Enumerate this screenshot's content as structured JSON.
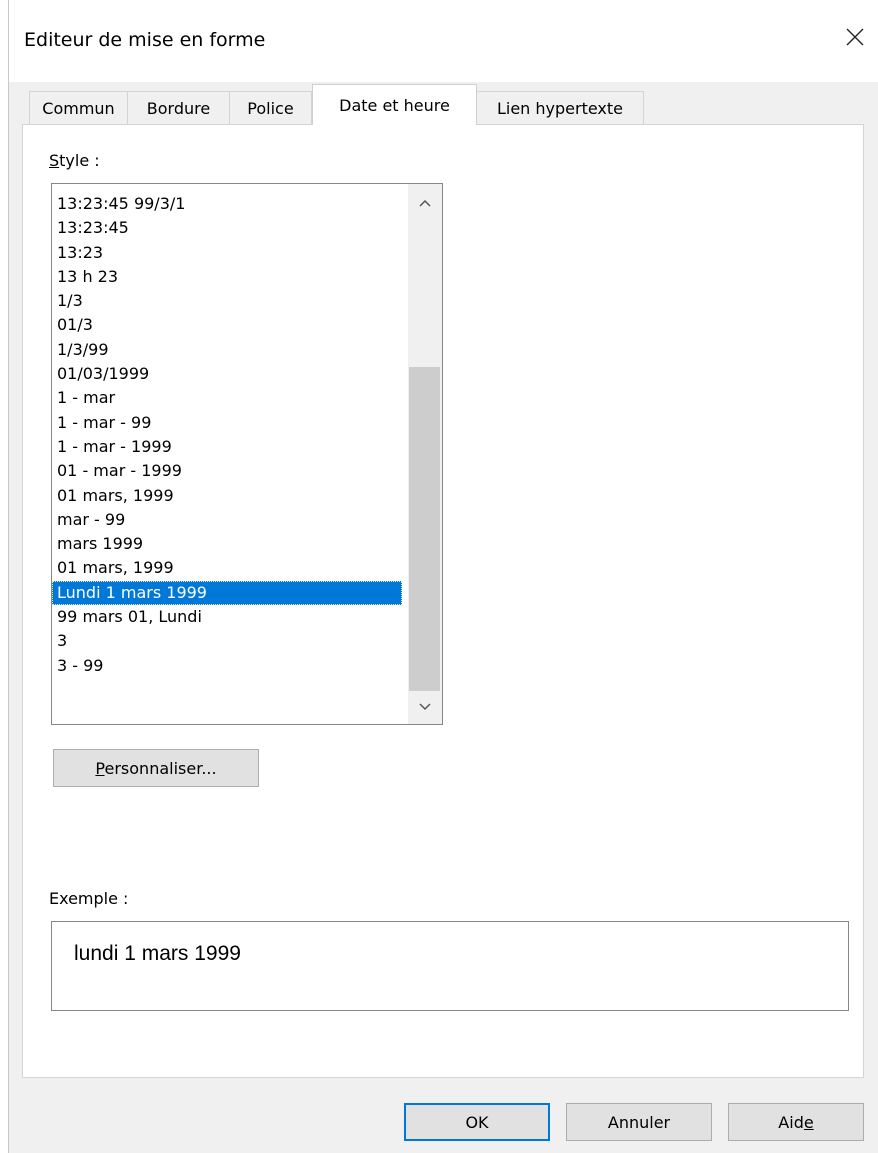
{
  "window": {
    "title": "Editeur de mise en forme",
    "close_icon": "close-icon"
  },
  "tabs": [
    {
      "label": "Commun",
      "active": false
    },
    {
      "label": "Bordure",
      "active": false
    },
    {
      "label": "Police",
      "active": false
    },
    {
      "label": "Date et heure",
      "active": true
    },
    {
      "label": "Lien hypertexte",
      "active": false
    }
  ],
  "style_section": {
    "label_accel": "S",
    "label_rest": "tyle :",
    "items": [
      "13:23:45 99/3/1",
      "13:23:45",
      "13:23",
      "13 h 23",
      "1/3",
      "01/3",
      "1/3/99",
      "01/03/1999",
      "1 - mar",
      "1 - mar - 99",
      "1 - mar - 1999",
      "01 - mar - 1999",
      "01 mars, 1999",
      "mar - 99",
      "mars 1999",
      "01 mars, 1999",
      "Lundi 1 mars 1999",
      "99 mars 01, Lundi",
      "3",
      "3 - 99"
    ],
    "selected_item": "Lundi 1 mars 1999",
    "scroll_up_icon": "chevron-up-icon",
    "scroll_down_icon": "chevron-down-icon"
  },
  "customize_button": {
    "accel": "P",
    "rest": "ersonnaliser..."
  },
  "example": {
    "label": "Exemple :",
    "value": "lundi 1 mars 1999"
  },
  "footer": {
    "ok_label": "OK",
    "cancel_label": "Annuler",
    "help_label_pre": "Aid",
    "help_label_accel": "e"
  },
  "colors": {
    "selection": "#0078d7",
    "window_bg": "#f0f0f0",
    "default_button_border": "#0078d7"
  }
}
